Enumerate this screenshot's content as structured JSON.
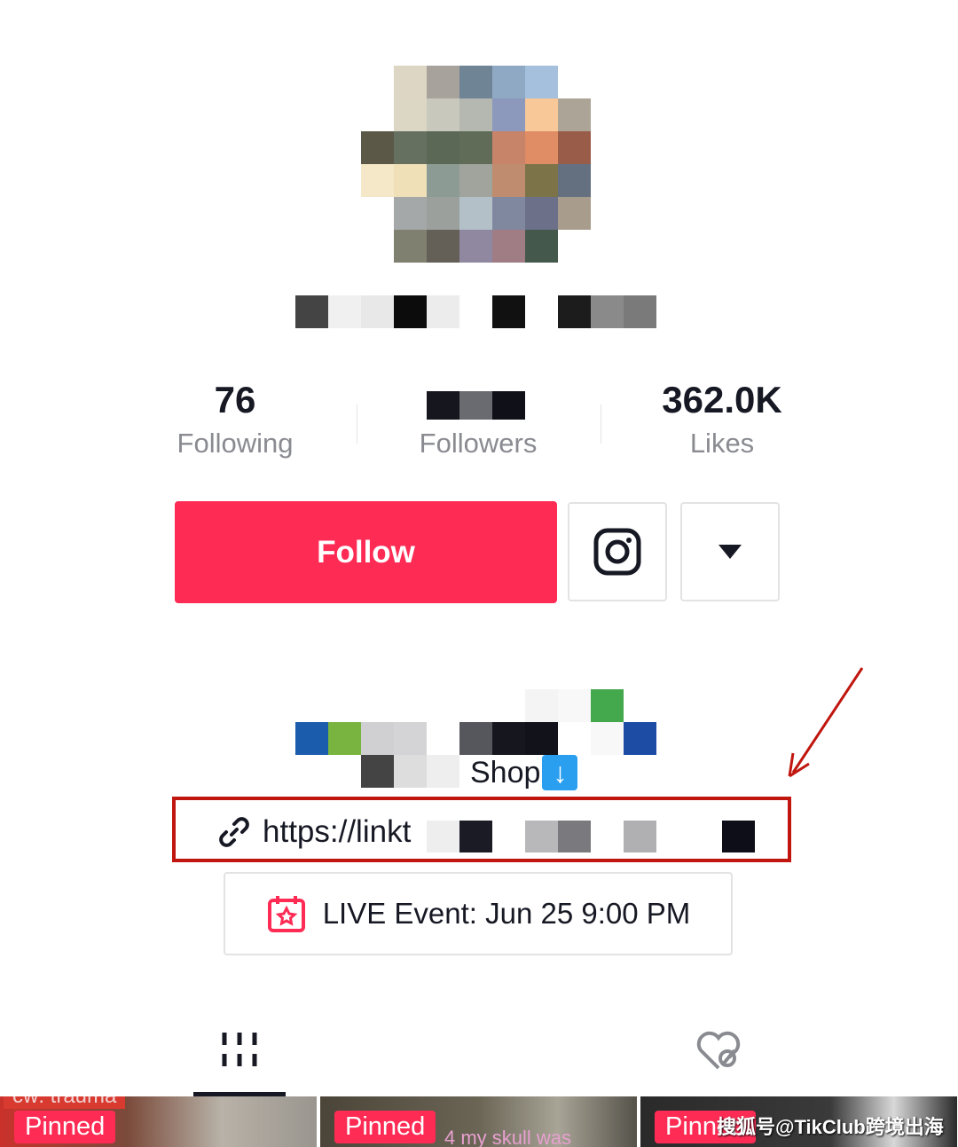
{
  "profile": {
    "stats": [
      {
        "value": "76",
        "label": "Following"
      },
      {
        "value": "",
        "label": "Followers"
      },
      {
        "value": "362.0K",
        "label": "Likes"
      }
    ],
    "follow_label": "Follow",
    "bio_shop": "Shop",
    "link": "https://linkt",
    "live_event": "LIVE Event: Jun 25 9:00 PM"
  },
  "tabs": [
    {
      "icon": "grid-icon",
      "active": true
    },
    {
      "icon": "liked-hidden-icon",
      "active": false
    }
  ],
  "videos": [
    {
      "badge": "Pinned",
      "caption": "cw: trauma"
    },
    {
      "badge": "Pinned",
      "caption": "4 my skull was"
    },
    {
      "badge": "Pinned",
      "caption": ""
    }
  ],
  "watermark": "搜狐号@TikClub跨境出海",
  "colors": {
    "accent": "#fe2c55",
    "annotation": "#c0160f"
  }
}
